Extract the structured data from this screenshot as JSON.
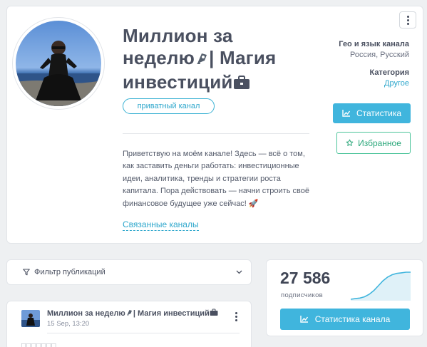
{
  "channel": {
    "title_line1": "Миллион за",
    "title_line2": "неделю",
    "title_line2_after": "| Магия",
    "title_line3": "инвестиций",
    "badge": "приватный канал",
    "description": "Приветствую на моём канале! Здесь — всё о том, как заставить деньги работать: инвестиционные идеи, аналитика, тренды и стратегии роста капитала. Пора действовать — начни строить своё финансовое будущее уже сейчас! 🚀",
    "related_link": "Связанные каналы",
    "geo_label": "Гео и язык канала",
    "geo_value": "Россия, Русский",
    "category_label": "Категория",
    "category_value": "Другое",
    "stats_button": "Статистика",
    "favorite_button": "Избранное"
  },
  "filter": {
    "label": "Фильтр публикаций"
  },
  "post": {
    "title": "Миллион за неделю",
    "title_after": "| Магия инвестиций",
    "date": "15 Sep, 13:20",
    "text": "□□□□□□□"
  },
  "subscribers": {
    "count": "27 586",
    "label": "подписчиков",
    "button": "Статистика канала",
    "trend": [
      8,
      8.5,
      9,
      10,
      12,
      15,
      19,
      23,
      26,
      28,
      29,
      29.5,
      30,
      30
    ]
  },
  "colors": {
    "accent": "#40b5dd",
    "favorite": "#4cc49a",
    "link": "#2ea7cc"
  }
}
